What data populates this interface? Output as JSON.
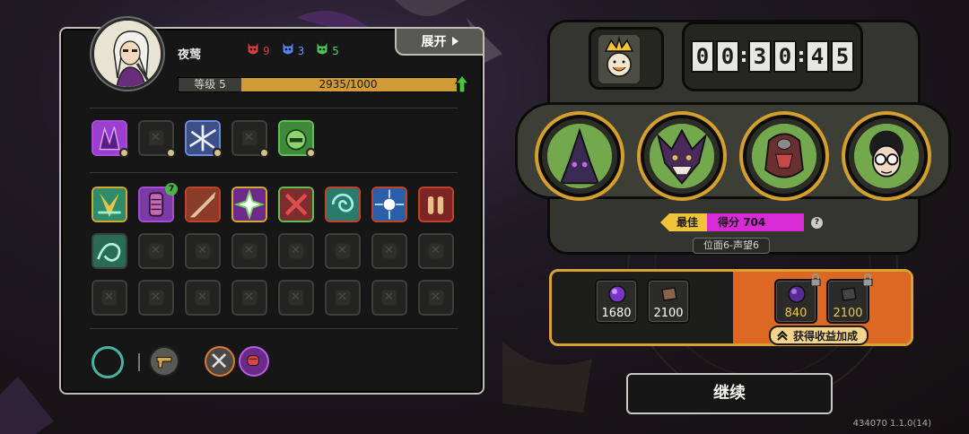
{
  "character": {
    "name": "夜莺",
    "expand_label": "展开",
    "mask_counts": [
      {
        "color": "#d73b3b",
        "count": "9"
      },
      {
        "color": "#5b7fe8",
        "count": "3"
      },
      {
        "color": "#45c45a",
        "count": "5"
      }
    ],
    "level_label": "等级 5",
    "xp_text": "2935/1000",
    "xp_progress": 1.0
  },
  "skill_slots_row1": [
    "purple-spike-skill",
    "empty",
    "blue-shards-skill",
    "empty",
    "green-helm-skill"
  ],
  "equipment_row1": [
    "green-burst-relic",
    "purple-scroll-relic",
    "brown-blade-relic",
    "white-star-relic",
    "red-x-relic",
    "teal-swirl-relic",
    "blue-spark-relic",
    "red-bullets-relic"
  ],
  "equipment_row1_level_badge": "7",
  "equipment_row2_first": "green-dragon-relic",
  "machine": {
    "timer_digits": [
      "0",
      "0",
      "3",
      "0",
      "4",
      "5"
    ],
    "best_label": "最佳",
    "score_label": "得分 704",
    "help": "?",
    "stage_label": "位面6-声望6",
    "bosses": [
      "green-shadow-boss",
      "horned-jester-boss",
      "crimson-beast-boss",
      "glasses-kid-boss"
    ]
  },
  "rewards": {
    "base": [
      {
        "icon": "purple-orb-icon",
        "value": "1680"
      },
      {
        "icon": "brown-plate-icon",
        "value": "2100"
      }
    ],
    "bonus": [
      {
        "icon": "purple-orb-icon",
        "value": "840"
      },
      {
        "icon": "dark-plate-icon",
        "value": "2100"
      }
    ],
    "bonus_label": "获得收益加成"
  },
  "continue_label": "继续",
  "version": "434070 1.1.0(14)"
}
